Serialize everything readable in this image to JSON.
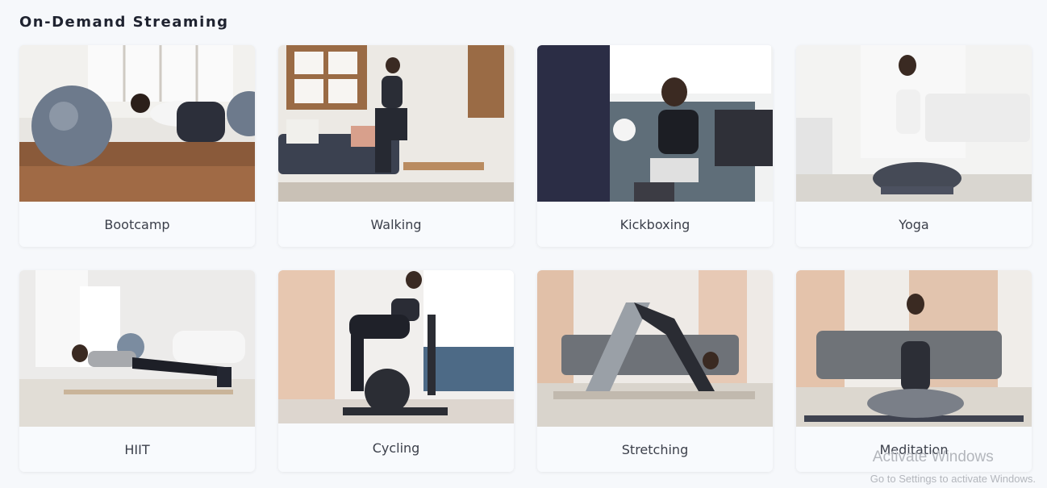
{
  "section": {
    "title": "On-Demand Streaming"
  },
  "cards": [
    {
      "label": "Bootcamp",
      "image_subject": "woman stretching over exercise ball"
    },
    {
      "label": "Walking",
      "image_subject": "woman doing high-knee march in living room"
    },
    {
      "label": "Kickboxing",
      "image_subject": "woman kickboxing by heavy bag"
    },
    {
      "label": "Yoga",
      "image_subject": "woman meditating in lotus pose"
    },
    {
      "label": "HIIT",
      "image_subject": "woman holding plank on mat"
    },
    {
      "label": "Cycling",
      "image_subject": "woman riding stationary bike"
    },
    {
      "label": "Stretching",
      "image_subject": "woman in downward dog pose"
    },
    {
      "label": "Meditation",
      "image_subject": "woman meditating in front of sofa"
    }
  ],
  "watermark": {
    "title": "Activate Windows",
    "subtitle": "Go to Settings to activate Windows."
  }
}
